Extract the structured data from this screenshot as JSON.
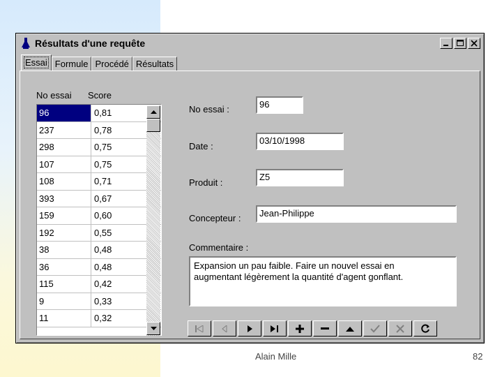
{
  "window": {
    "title": "Résultats d'une requête"
  },
  "tabs": [
    {
      "label": "Essai",
      "active": true
    },
    {
      "label": "Formule",
      "active": false
    },
    {
      "label": "Procédé",
      "active": false
    },
    {
      "label": "Résultats",
      "active": false
    }
  ],
  "list": {
    "headers": {
      "no_essai": "No essai",
      "score": "Score"
    },
    "rows": [
      {
        "no": "96",
        "score": "0,81",
        "selected": true
      },
      {
        "no": "237",
        "score": "0,78"
      },
      {
        "no": "298",
        "score": "0,75"
      },
      {
        "no": "107",
        "score": "0,75"
      },
      {
        "no": "108",
        "score": "0,71"
      },
      {
        "no": "393",
        "score": "0,67"
      },
      {
        "no": "159",
        "score": "0,60"
      },
      {
        "no": "192",
        "score": "0,55"
      },
      {
        "no": "38",
        "score": "0,48"
      },
      {
        "no": "36",
        "score": "0,48"
      },
      {
        "no": "115",
        "score": "0,42"
      },
      {
        "no": "9",
        "score": "0,33"
      },
      {
        "no": "11",
        "score": "0,32"
      }
    ]
  },
  "form": {
    "no_essai_label": "No essai :",
    "no_essai_value": "96",
    "date_label": "Date :",
    "date_value": "03/10/1998",
    "produit_label": "Produit :",
    "produit_value": "Z5",
    "concepteur_label": "Concepteur :",
    "concepteur_value": "Jean-Philippe",
    "commentaire_label": "Commentaire :",
    "commentaire_line1": "Expansion un pau faible. Faire un nouvel essai en",
    "commentaire_line2": "augmentant légèrement la quantité d'agent gonflant."
  },
  "navigator": {
    "buttons": [
      "first-icon",
      "prior-icon",
      "next-icon",
      "last-icon",
      "insert-icon",
      "delete-icon",
      "edit-icon",
      "post-icon",
      "cancel-icon",
      "refresh-icon"
    ]
  },
  "footer": {
    "author": "Alain Mille",
    "page": "82"
  }
}
